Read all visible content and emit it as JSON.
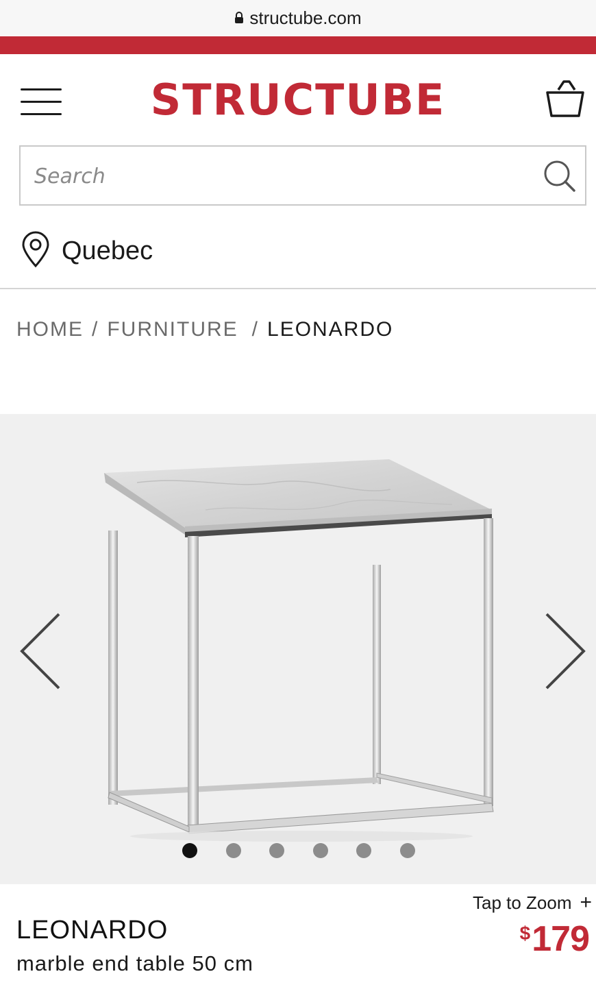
{
  "browser": {
    "url": "structube.com",
    "lock_icon": "lock-icon"
  },
  "brand": {
    "logo_text": "STRUCTUBE",
    "accent_color": "#c12a36"
  },
  "header": {
    "menu_icon": "hamburger-menu-icon",
    "cart_icon": "shopping-bag-icon"
  },
  "search": {
    "placeholder": "Search",
    "value": "",
    "icon": "search-icon"
  },
  "location": {
    "icon": "location-pin-icon",
    "label": "Quebec"
  },
  "breadcrumb": {
    "items": [
      "HOME",
      "FURNITURE"
    ],
    "separator": "/",
    "current": "LEONARDO"
  },
  "gallery": {
    "prev_icon": "chevron-left-icon",
    "next_icon": "chevron-right-icon",
    "slide_count": 6,
    "active_index": 0
  },
  "product": {
    "zoom_label": "Tap to Zoom",
    "zoom_icon": "plus-icon",
    "zoom_plus": "+",
    "name": "LEONARDO",
    "description": "marble end table 50 cm",
    "price_currency": "$",
    "price_amount": "179"
  }
}
